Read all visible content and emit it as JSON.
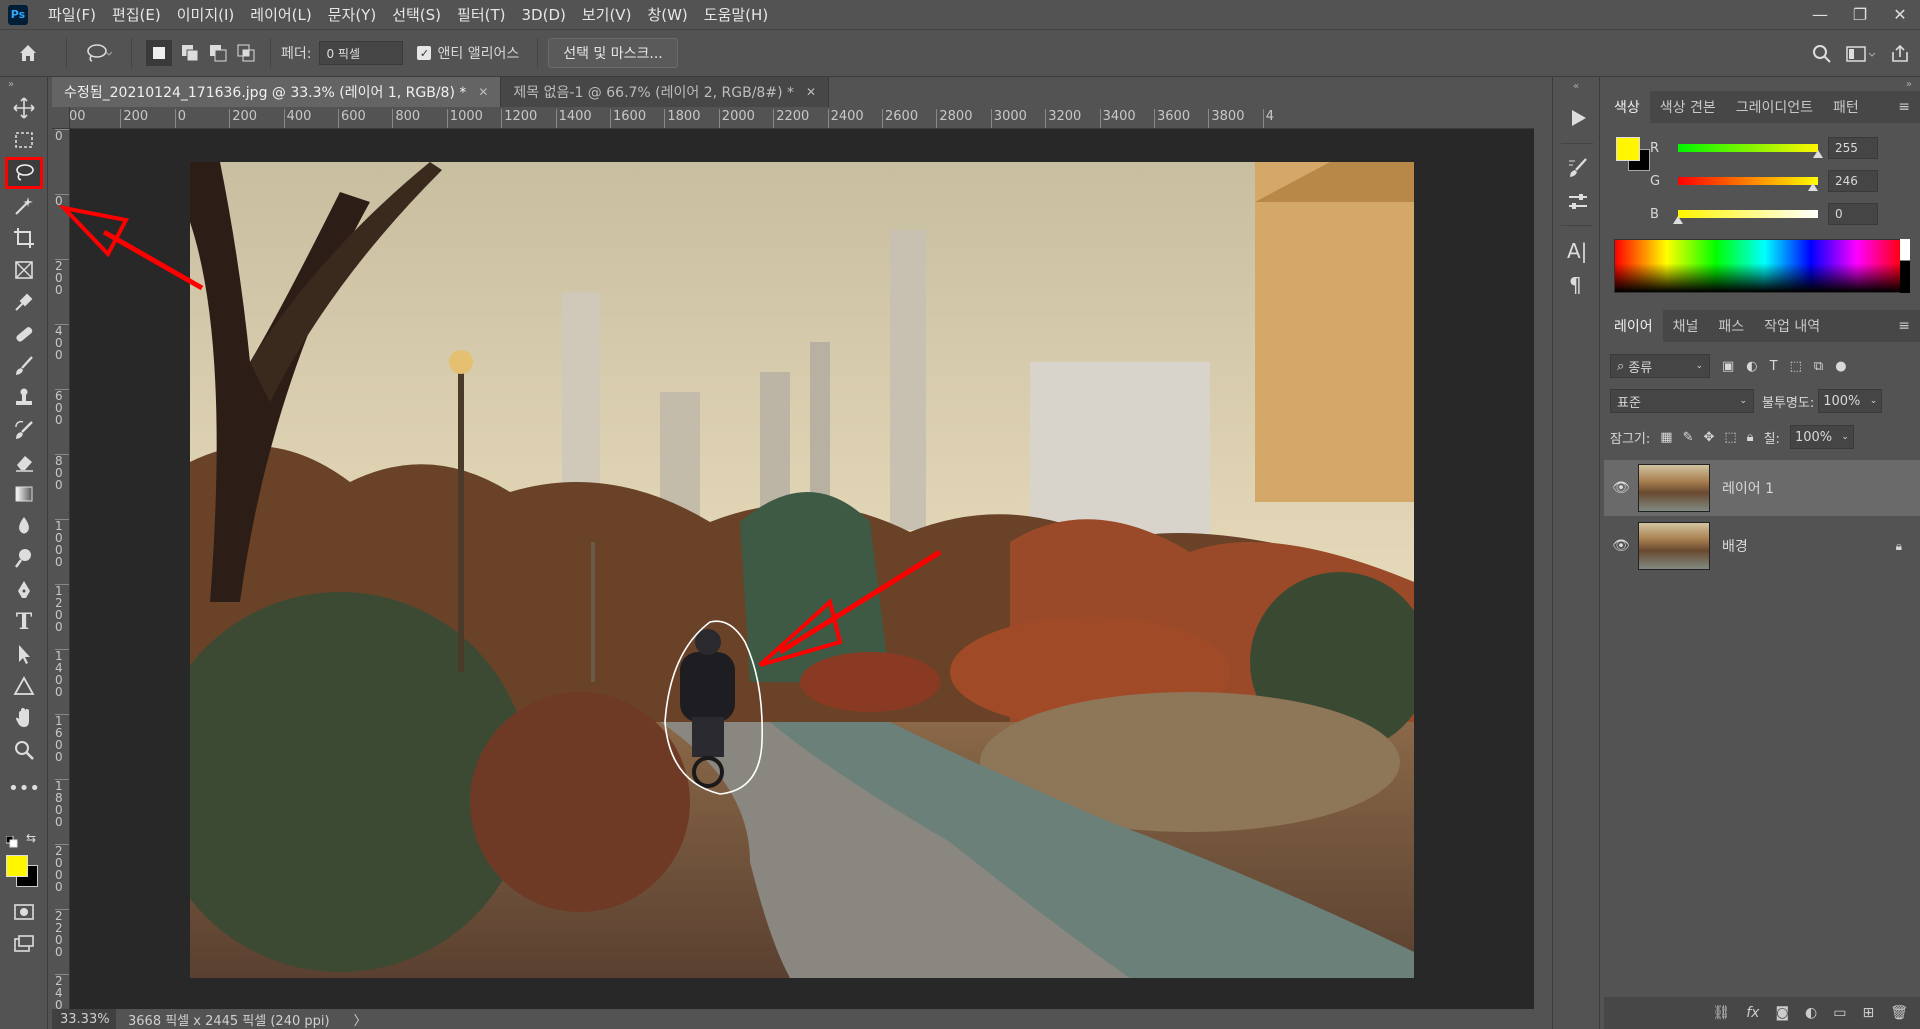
{
  "app": {
    "logo": "Ps"
  },
  "menu": [
    "파일(F)",
    "편집(E)",
    "이미지(I)",
    "레이어(L)",
    "문자(Y)",
    "선택(S)",
    "필터(T)",
    "3D(D)",
    "보기(V)",
    "창(W)",
    "도움말(H)"
  ],
  "window_controls": {
    "minimize": "—",
    "restore": "❐",
    "close": "✕"
  },
  "options": {
    "feather_label": "페더:",
    "feather_value": "0 픽셀",
    "anti_alias_label": "앤티 앨리어스",
    "anti_alias_checked": true,
    "select_mask_label": "선택 및 마스크..."
  },
  "tabs": [
    {
      "label": "수정됨_20210124_171636.jpg @ 33.3% (레이어 1, RGB/8) *",
      "active": true
    },
    {
      "label": "제목 없음-1 @ 66.7% (레이어 2, RGB/8#) *",
      "active": false
    }
  ],
  "ruler": {
    "h": [
      "00",
      "200",
      "0",
      "200",
      "400",
      "600",
      "800",
      "1000",
      "1200",
      "1400",
      "1600",
      "1800",
      "2000",
      "2200",
      "2400",
      "2600",
      "2800",
      "3000",
      "3200",
      "3400",
      "3600",
      "3800",
      "4"
    ],
    "v": [
      "0",
      "0",
      "2\n0\n0",
      "4\n0\n0",
      "6\n0\n0",
      "8\n0\n0",
      "1\n0\n0\n0",
      "1\n2\n0\n0",
      "1\n4\n0\n0",
      "1\n6\n0\n0",
      "1\n8\n0\n0",
      "2\n0\n0\n0",
      "2\n2\n0\n0",
      "2\n4\n0"
    ]
  },
  "status": {
    "zoom": "33.33%",
    "info": "3668 픽셀 x 2445 픽셀 (240 ppi)",
    "arrow": "〉"
  },
  "color_panel": {
    "tabs": [
      "색상",
      "색상 견본",
      "그레이디언트",
      "패턴"
    ],
    "foreground": "#fff600",
    "background": "#000000",
    "channels": [
      {
        "label": "R",
        "value": "255",
        "level": 1.0
      },
      {
        "label": "G",
        "value": "246",
        "level": 0.965
      },
      {
        "label": "B",
        "value": "0",
        "level": 0.0
      }
    ]
  },
  "layers_panel": {
    "tabs": [
      "레이어",
      "채널",
      "패스",
      "작업 내역"
    ],
    "filter": "종류",
    "blend_mode": "표준",
    "opacity_label": "불투명도:",
    "opacity_value": "100%",
    "lock_label": "잠그기:",
    "fill_label": "칠:",
    "fill_value": "100%",
    "layers": [
      {
        "name": "레이어 1",
        "selected": true,
        "locked": false
      },
      {
        "name": "배경",
        "selected": false,
        "locked": true
      }
    ]
  },
  "accent": "#ff0000"
}
